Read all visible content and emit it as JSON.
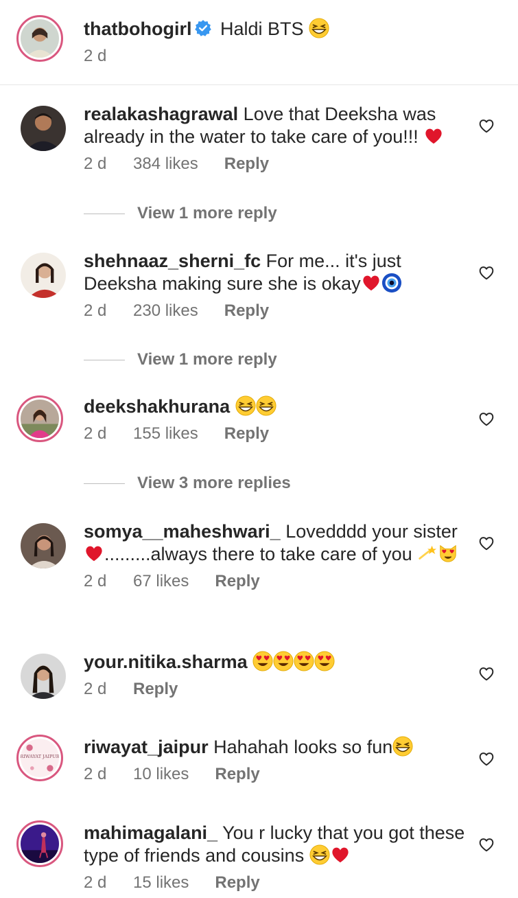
{
  "caption": {
    "username": "thatbohogirl",
    "verified": true,
    "text": "Haldi BTS",
    "time": "2 d",
    "emoji": "grinning-squint-face"
  },
  "comments": [
    {
      "username": "realakashagrawal",
      "text": "Love that Deeksha was already in the water to take care of you!!!",
      "emojis": [
        "red-heart"
      ],
      "time": "2 d",
      "likes": "384 likes",
      "reply": "Reply",
      "view_replies": "View 1 more reply"
    },
    {
      "username": "shehnaaz_sherni_fc",
      "text": "For me... it's just Deeksha making sure she is okay",
      "emojis": [
        "red-heart",
        "nazar-amulet"
      ],
      "time": "2 d",
      "likes": "230 likes",
      "reply": "Reply",
      "view_replies": "View 1 more reply"
    },
    {
      "username": "deekshakhurana",
      "text": "",
      "emojis": [
        "grinning-squint-face",
        "grinning-squint-face"
      ],
      "time": "2 d",
      "likes": "155 likes",
      "reply": "Reply",
      "view_replies": "View 3 more replies"
    },
    {
      "username": "somya__maheshwari_",
      "text_a": "Lovedddd your sister",
      "text_b": ".........always there to take care of you",
      "emojis": [
        "red-heart",
        "dizzy",
        "smiling-cat-heart-eyes"
      ],
      "time": "2 d",
      "likes": "67 likes",
      "reply": "Reply"
    },
    {
      "username": "your.nitika.sharma",
      "text": "",
      "emojis": [
        "heart-eyes",
        "heart-eyes",
        "heart-eyes",
        "heart-eyes"
      ],
      "time": "2 d",
      "reply": "Reply"
    },
    {
      "username": "riwayat_jaipur",
      "text": "Hahahah looks so fun",
      "emojis": [
        "grinning-squint-face"
      ],
      "time": "2 d",
      "likes": "10 likes",
      "reply": "Reply",
      "avatar_text": "RIWAYAT JAIPUR"
    },
    {
      "username": "mahimagalani_",
      "text": "You r lucky that you got these type of friends and cousins",
      "emojis": [
        "grinning-squint-face",
        "red-heart"
      ],
      "time": "2 d",
      "likes": "15 likes",
      "reply": "Reply"
    }
  ],
  "icons": {
    "like": "heart-outline-icon",
    "verified": "verified-badge-icon"
  },
  "colors": {
    "text": "#262626",
    "meta": "#737373",
    "verified": "#3897f0",
    "story_ring": "#d9577f",
    "heart_red": "#e0162b"
  }
}
